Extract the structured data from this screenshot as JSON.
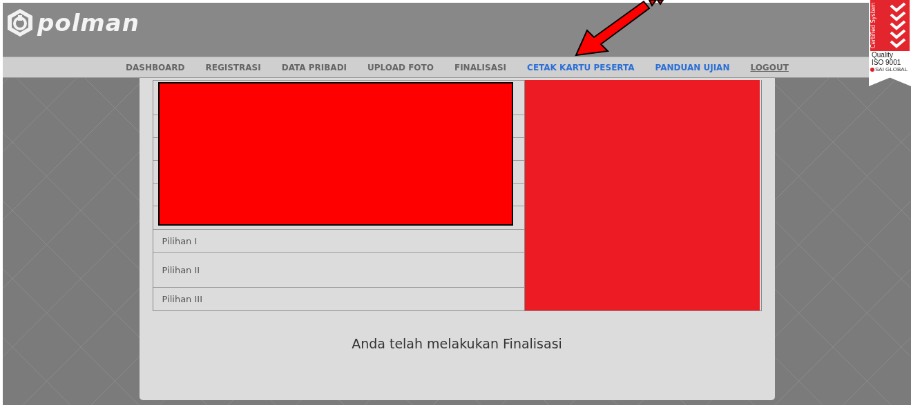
{
  "header": {
    "logo_text": "polman"
  },
  "nav": [
    {
      "label": "DASHBOARD",
      "kind": "plain"
    },
    {
      "label": "REGISTRASI",
      "kind": "plain"
    },
    {
      "label": "DATA PRIBADI",
      "kind": "plain"
    },
    {
      "label": "UPLOAD FOTO",
      "kind": "plain"
    },
    {
      "label": "FINALISASI",
      "kind": "plain"
    },
    {
      "label": "CETAK KARTU PESERTA",
      "kind": "link"
    },
    {
      "label": "PANDUAN UJIAN",
      "kind": "link"
    },
    {
      "label": "LOGOUT",
      "kind": "underlined"
    }
  ],
  "badge": {
    "vertical_text": "Certified System",
    "line_1": "Quality",
    "line_2": "ISO 9001",
    "brand": "SAI GLOBAL"
  },
  "table": {
    "rows": [
      {
        "label": "Pilihan I"
      },
      {
        "label": "Pilihan II"
      },
      {
        "label": "Pilihan III"
      }
    ]
  },
  "message": "Anda telah melakukan Finalisasi"
}
